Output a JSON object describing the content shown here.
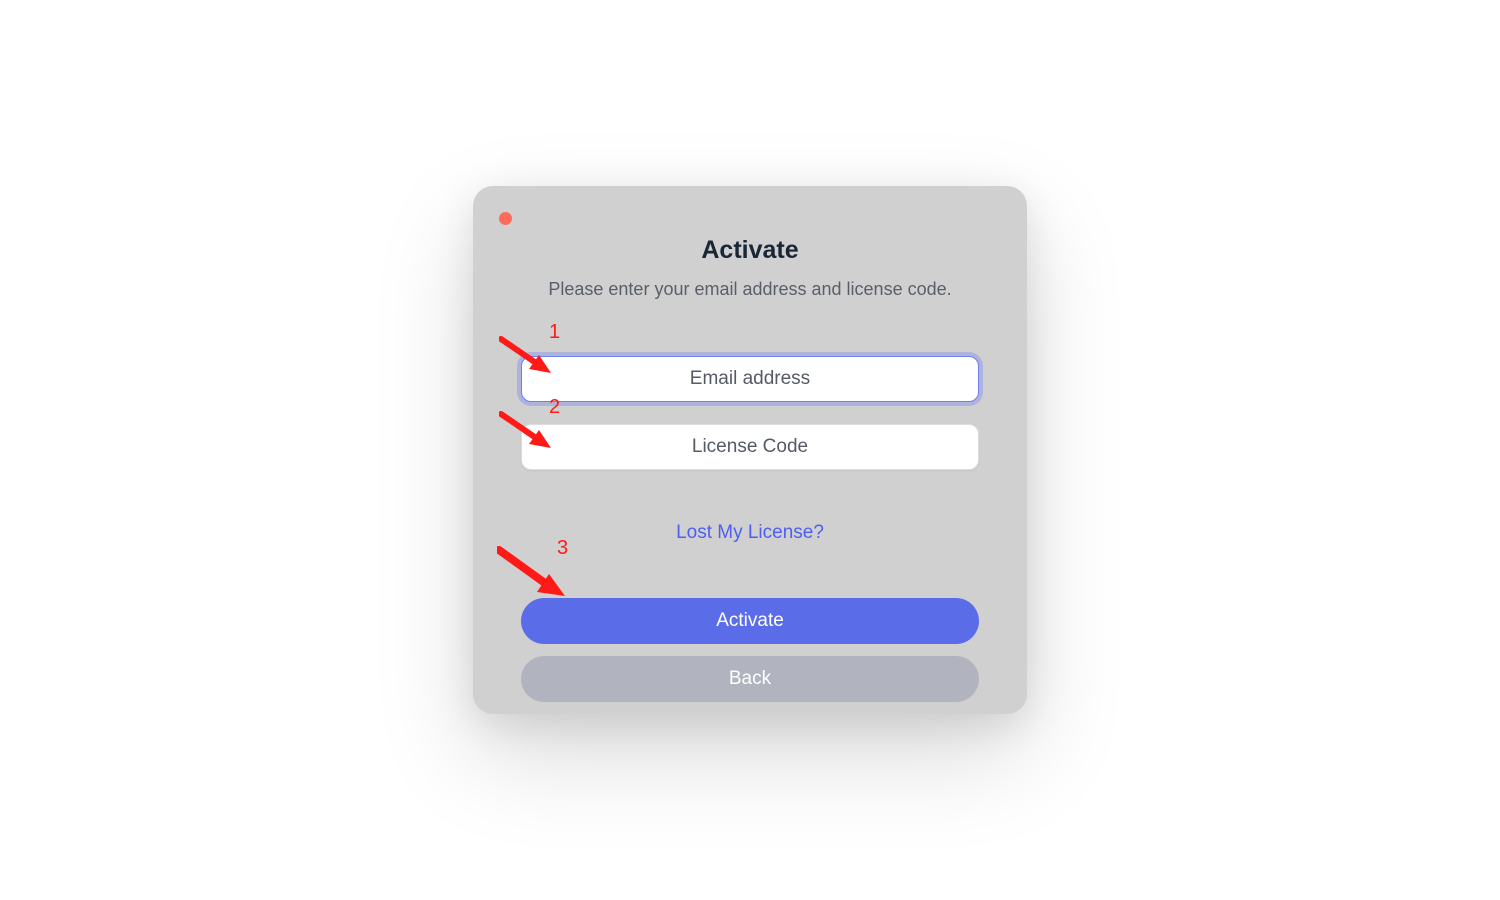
{
  "window": {
    "title": "Activate",
    "subtitle": "Please enter your email address and license code."
  },
  "fields": {
    "email": {
      "placeholder": "Email address",
      "value": ""
    },
    "license": {
      "placeholder": "License Code",
      "value": ""
    }
  },
  "links": {
    "lost_license": "Lost My License?"
  },
  "buttons": {
    "activate": "Activate",
    "back": "Back"
  },
  "annotations": {
    "n1": "1",
    "n2": "2",
    "n3": "3"
  },
  "colors": {
    "close_dot": "#ff6a5b",
    "accent": "#5b6ce8",
    "focus_ring": "#6f7ef2",
    "link": "#4d5ff2",
    "annotation_red": "#ff1a17"
  }
}
